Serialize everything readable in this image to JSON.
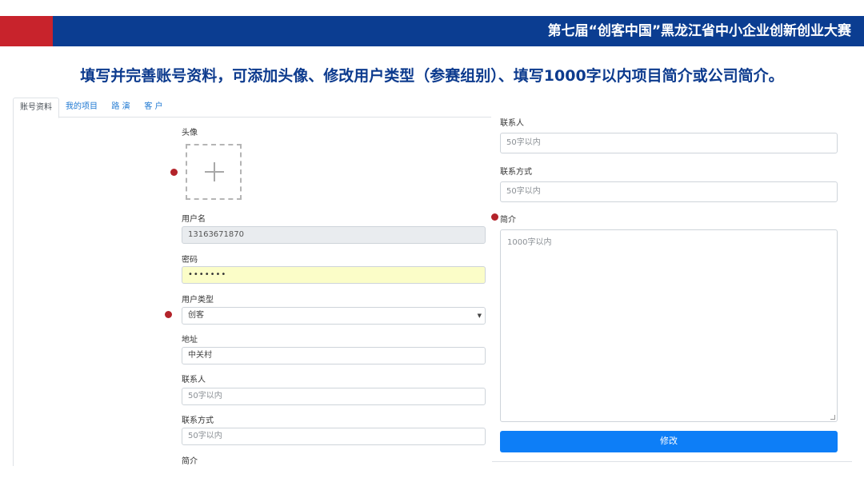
{
  "banner": {
    "title": "第七届“创客中国”黑龙江省中小企业创新创业大赛",
    "colors": {
      "primary": "#0b3d91",
      "accent": "#c8232c"
    }
  },
  "headline": "填写并完善账号资料，可添加头像、修改用户类型（参赛组别）、填写1000字以内项目简介或公司简介。",
  "tabs": [
    {
      "label": "账号资料",
      "active": true
    },
    {
      "label": "我的项目",
      "active": false
    },
    {
      "label": "路 演",
      "active": false
    },
    {
      "label": "客 户",
      "active": false
    }
  ],
  "form_left": {
    "avatar": {
      "label": "头像",
      "icon": "plus-icon"
    },
    "username": {
      "label": "用户名",
      "value": "13163671870"
    },
    "password": {
      "label": "密码",
      "value": "•••••••"
    },
    "user_type": {
      "label": "用户类型",
      "value": "创客",
      "icon": "caret-down-icon"
    },
    "address": {
      "label": "地址",
      "value": "中关村"
    },
    "contact": {
      "label": "联系人",
      "placeholder": "50字以内"
    },
    "contact_method": {
      "label": "联系方式",
      "placeholder": "50字以内"
    },
    "intro": {
      "label": "简介"
    }
  },
  "form_right": {
    "contact": {
      "label": "联系人",
      "placeholder": "50字以内"
    },
    "contact_method": {
      "label": "联系方式",
      "placeholder": "50字以内"
    },
    "intro": {
      "label": "简介",
      "placeholder": "1000字以内"
    },
    "submit_label": "修改"
  },
  "marker_color": "#b3232a",
  "button_color": "#0d7ef7"
}
